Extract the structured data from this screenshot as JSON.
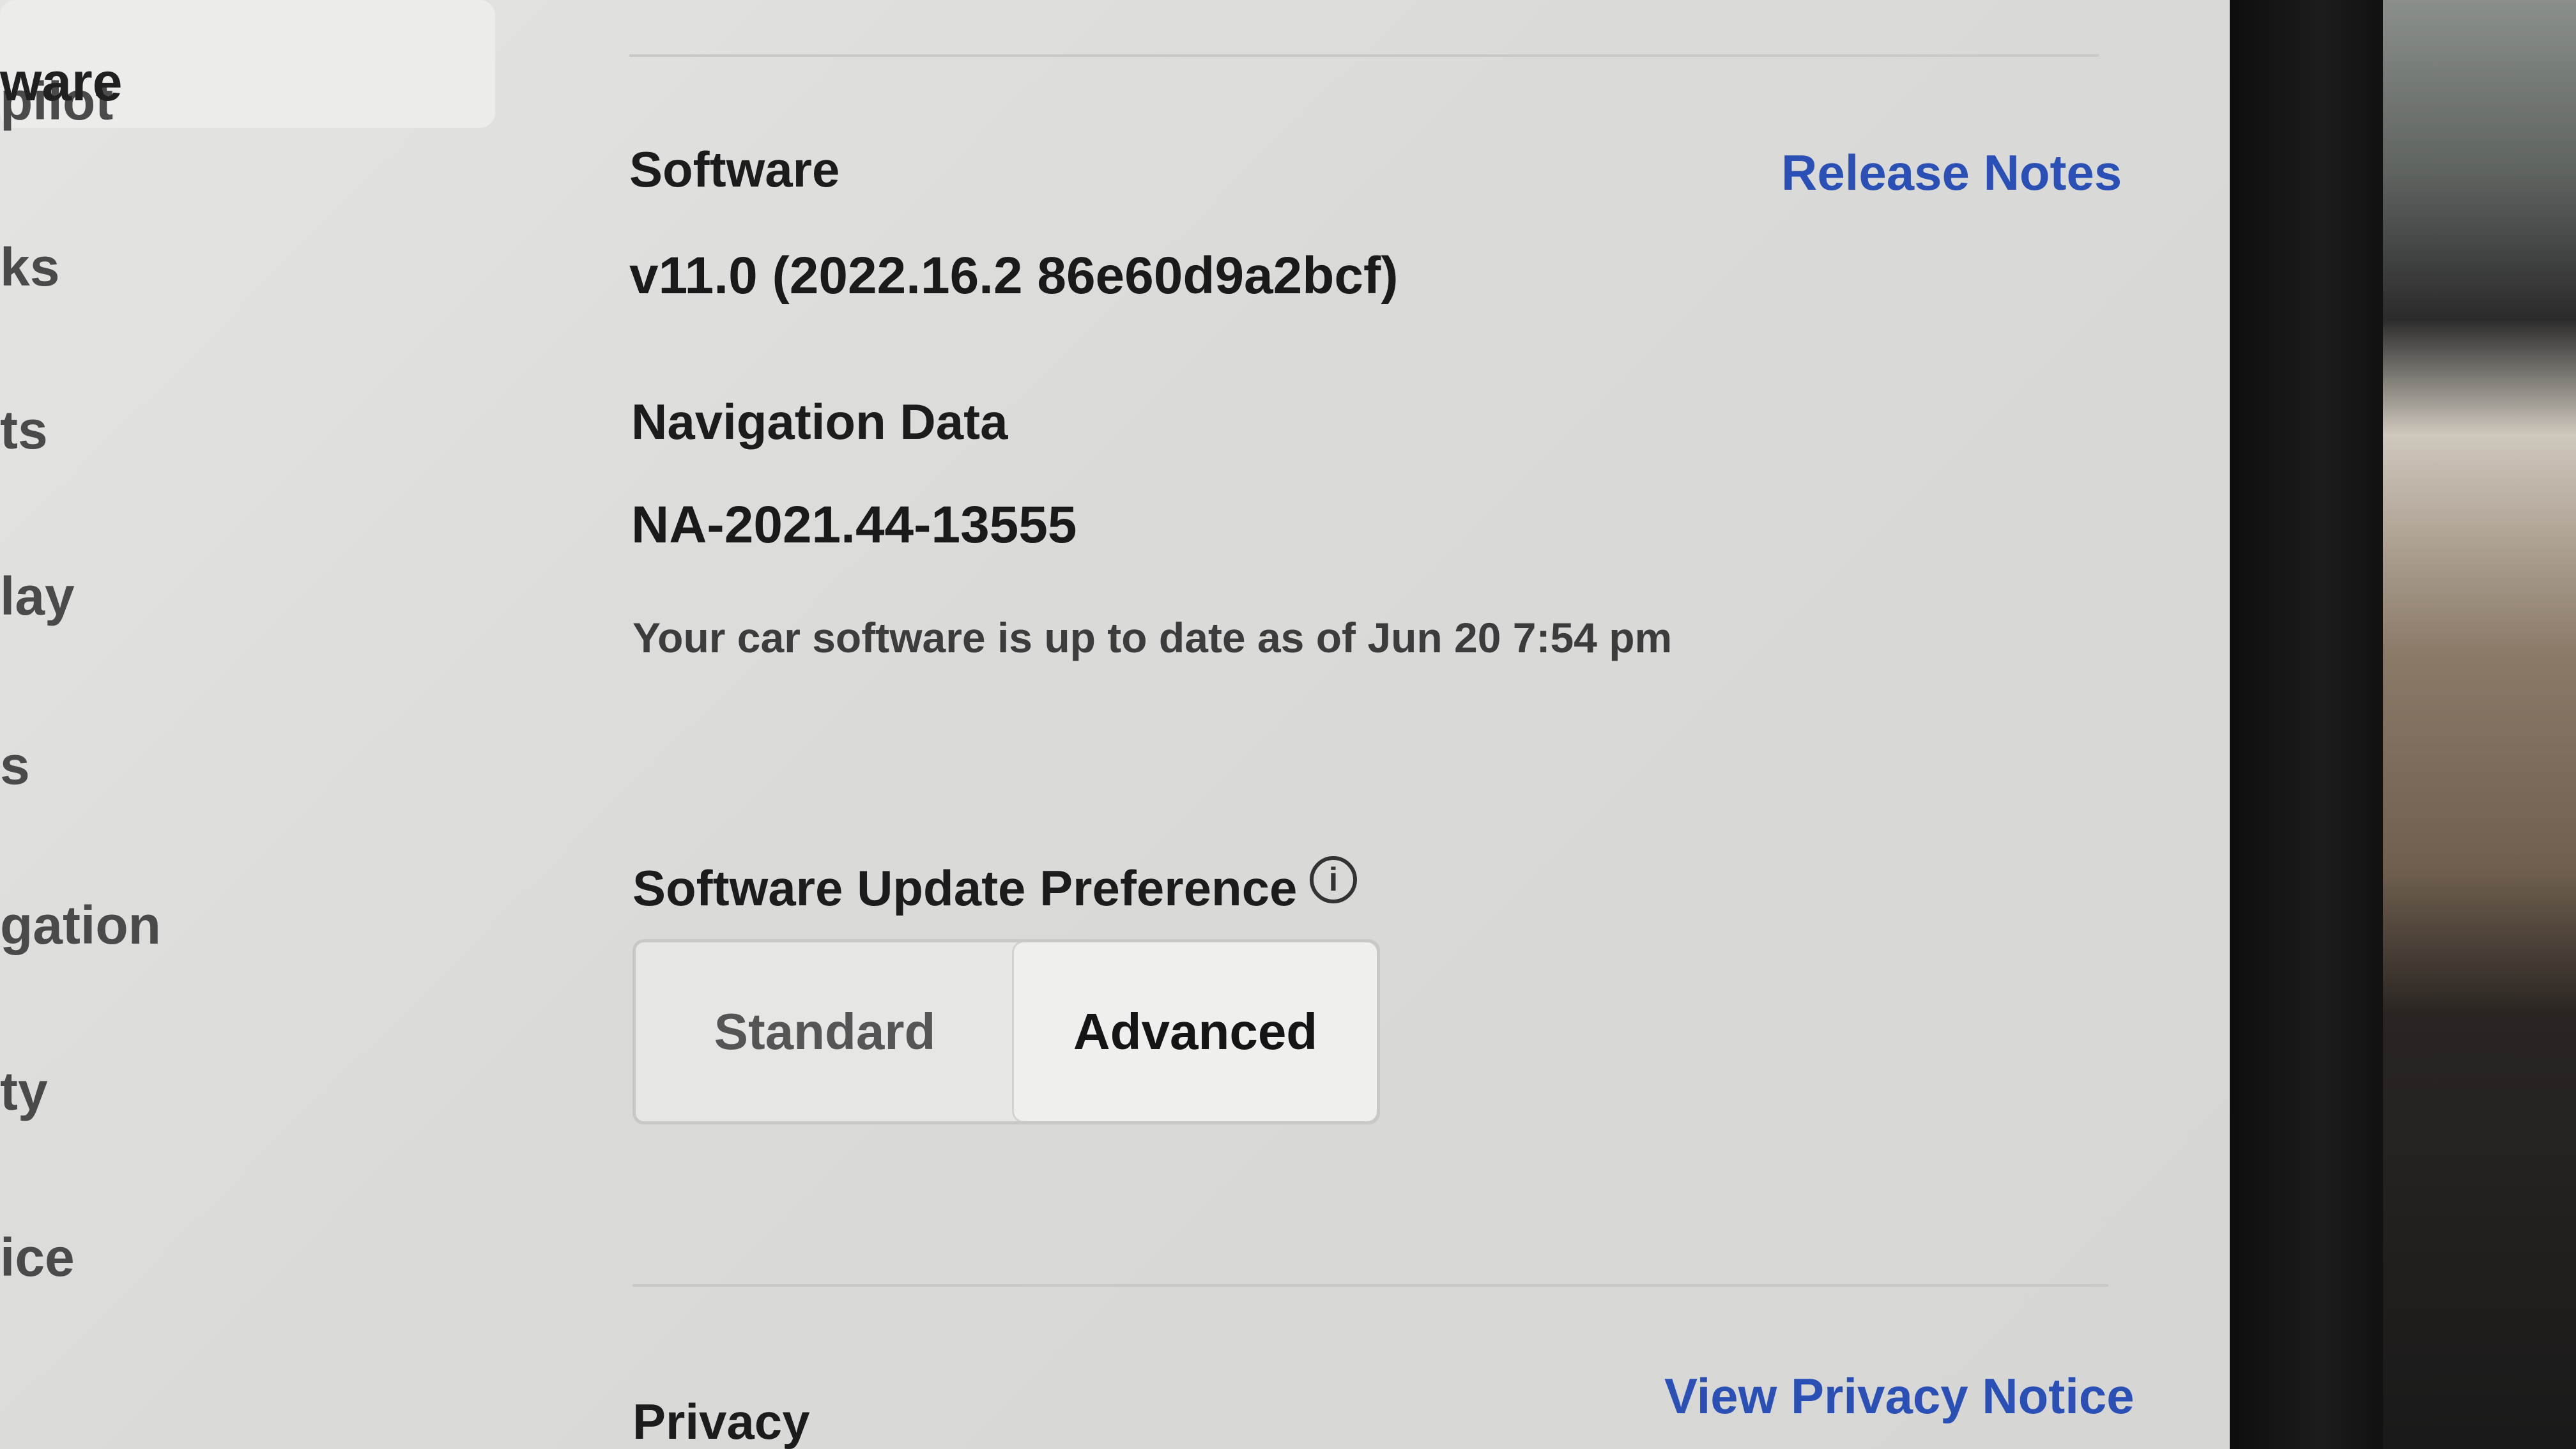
{
  "sidebar": {
    "items": [
      {
        "label": "pilot"
      },
      {
        "label": "ks"
      },
      {
        "label": "ts"
      },
      {
        "label": "lay"
      },
      {
        "label": "s"
      },
      {
        "label": "gation"
      },
      {
        "label": "ty"
      },
      {
        "label": "ice"
      },
      {
        "label": "ware",
        "selected": true
      }
    ]
  },
  "software": {
    "heading": "Software",
    "release_notes_link": "Release Notes",
    "version": "v11.0 (2022.16.2 86e60d9a2bcf)"
  },
  "navigation_data": {
    "heading": "Navigation Data",
    "version": "NA-2021.44-13555"
  },
  "status_message": "Your car software is up to date as of Jun 20 7:54 pm",
  "update_preference": {
    "heading": "Software Update Preference",
    "info_icon": "info-icon",
    "options": [
      "Standard",
      "Advanced"
    ],
    "selected": "Advanced"
  },
  "privacy": {
    "heading": "Privacy",
    "view_notice_link": "View Privacy Notice"
  },
  "colors": {
    "link": "#2a4fb5",
    "background": "#dadad8",
    "selected_segment": "#efefed"
  }
}
